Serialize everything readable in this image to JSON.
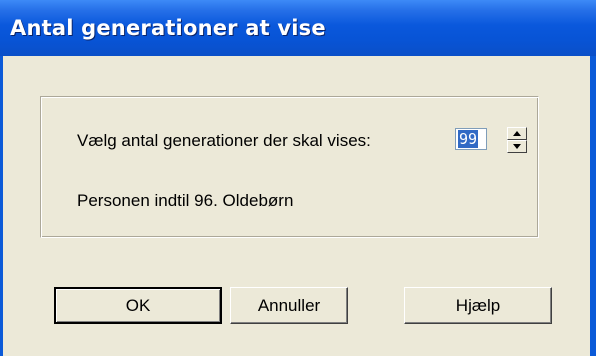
{
  "window": {
    "title": "Antal generationer at vise"
  },
  "form": {
    "prompt_label": "Vælg antal generationer der skal vises:",
    "generations_value": "99",
    "info_text": "Personen indtil 96. Oldebørn"
  },
  "buttons": {
    "ok_label": "OK",
    "cancel_label": "Annuller",
    "help_label": "Hjælp"
  },
  "icons": {
    "spin_up": "arrow-up-icon",
    "spin_down": "arrow-down-icon"
  },
  "colors": {
    "titlebar": "#0a58dc",
    "dialog_background": "#ece9d8",
    "selection": "#316ac5"
  }
}
